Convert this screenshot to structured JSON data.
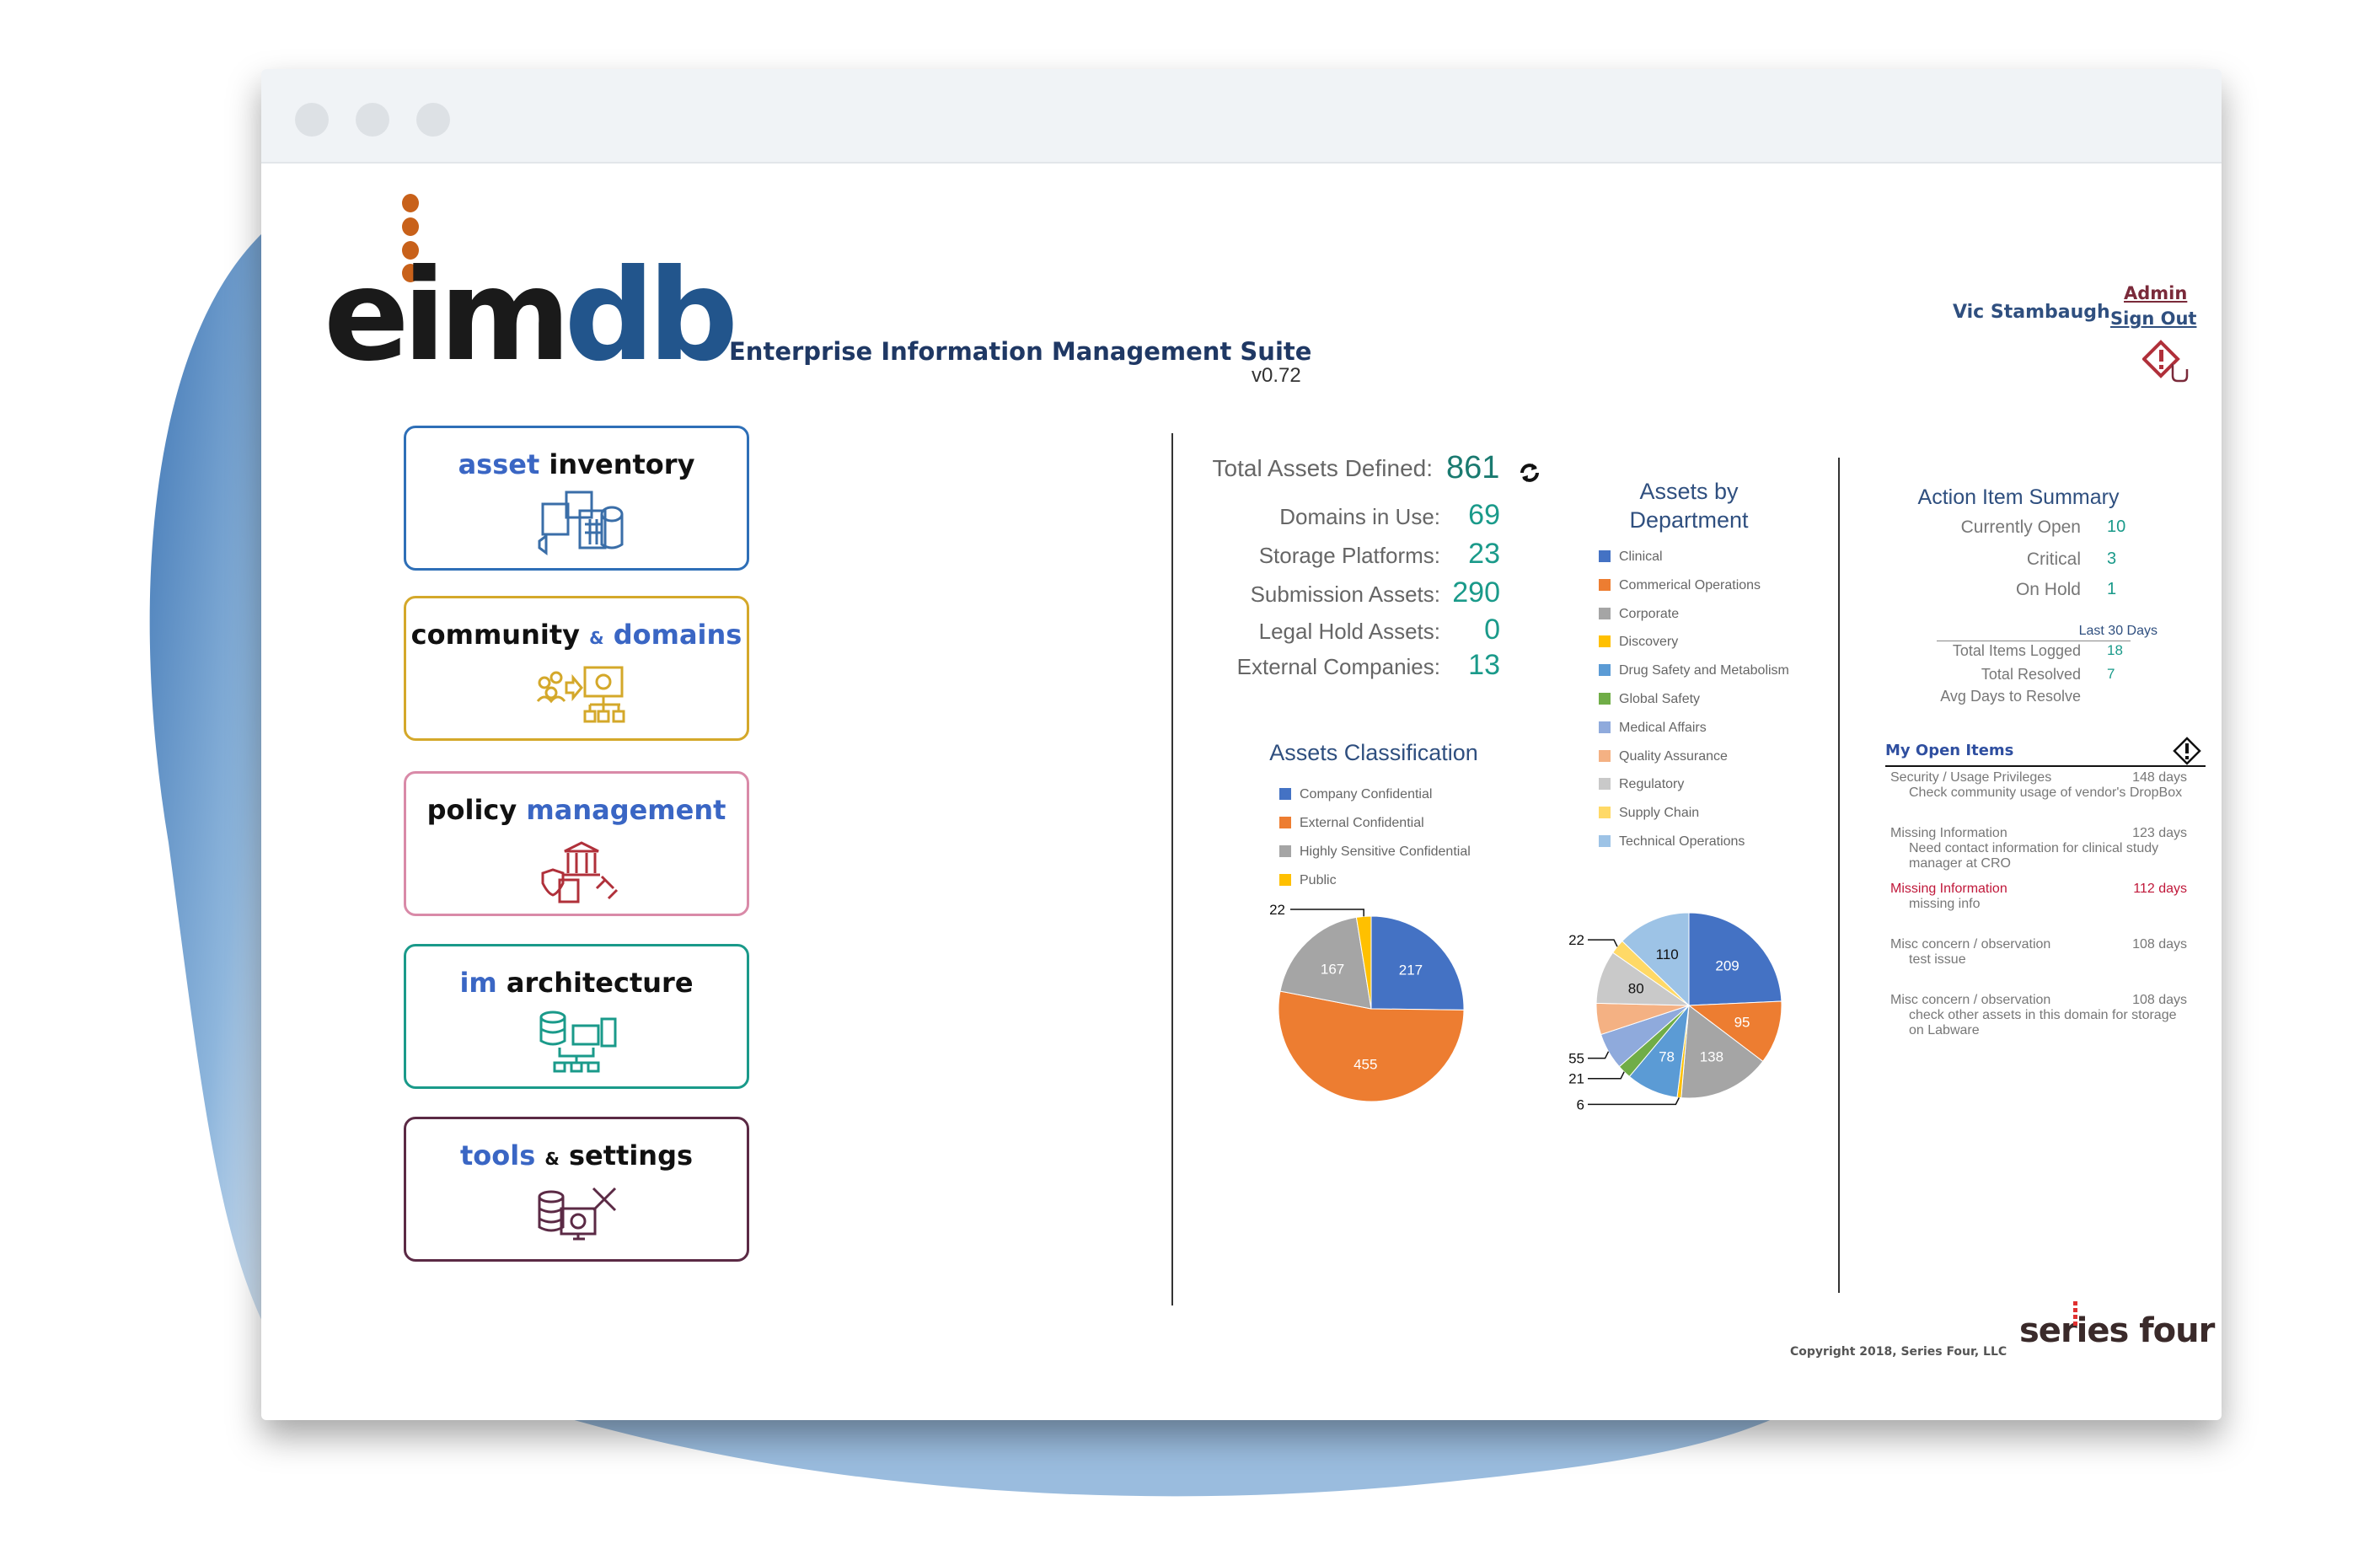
{
  "header": {
    "logo_text": "eimdb",
    "suite_title": "Enterprise Information Management Suite",
    "version": "v0.72",
    "user_name": "Vic Stambaugh",
    "admin_link": "Admin",
    "sign_out_link": "Sign Out",
    "report_issue_icon": "alert-diamond-pointer-icon"
  },
  "tiles": [
    {
      "word1": "asset",
      "word2": "inventory",
      "border": "#2e6fb7",
      "icon": "asset-collection-icon"
    },
    {
      "word1": "community",
      "amp": "&",
      "word2": "domains",
      "border": "#d4a82a",
      "icon": "community-domains-icon"
    },
    {
      "word1": "policy",
      "word2": "management",
      "border": "#d98aa8",
      "icon": "policy-gavel-icon"
    },
    {
      "word1": "im",
      "word2": "architecture",
      "border": "#1a9a8a",
      "icon": "architecture-database-icon"
    },
    {
      "word1": "tools",
      "amp": "&",
      "word2": "settings",
      "border": "#5b2a45",
      "icon": "tools-settings-icon"
    }
  ],
  "stats": {
    "total_label": "Total Assets Defined:",
    "total_value": "861",
    "refresh_icon": "refresh-icon",
    "rows": [
      {
        "label": "Domains in Use:",
        "value": "69"
      },
      {
        "label": "Storage Platforms:",
        "value": "23"
      },
      {
        "label": "Submission Assets:",
        "value": "290"
      },
      {
        "label": "Legal Hold Assets:",
        "value": "0"
      },
      {
        "label": "External Companies:",
        "value": "13"
      }
    ]
  },
  "chart_data": [
    {
      "type": "pie",
      "title": "Assets Classification",
      "legend_position": "top",
      "slices": [
        {
          "name": "Company Confidential",
          "value": 217,
          "color": "#4472c4"
        },
        {
          "name": "External Confidential",
          "value": 455,
          "color": "#ed7d31"
        },
        {
          "name": "Highly Sensitive Confidential",
          "value": 167,
          "color": "#a5a5a5"
        },
        {
          "name": "Public",
          "value": 22,
          "color": "#ffc000"
        }
      ]
    },
    {
      "type": "pie",
      "title_line1": "Assets by",
      "title_line2": "Department",
      "legend_position": "top",
      "slices": [
        {
          "name": "Clinical",
          "value": 209,
          "color": "#4472c4"
        },
        {
          "name": "Commerical Operations",
          "value": 95,
          "color": "#ed7d31"
        },
        {
          "name": "Corporate",
          "value": 138,
          "color": "#a5a5a5"
        },
        {
          "name": "Discovery",
          "value": 6,
          "color": "#ffc000"
        },
        {
          "name": "Drug Safety and Metabolism",
          "value": 78,
          "color": "#5b9bd5"
        },
        {
          "name": "Global Safety",
          "value": 21,
          "color": "#70ad47"
        },
        {
          "name": "Medical Affairs",
          "value": 55,
          "color": "#8faadc"
        },
        {
          "name": "Quality Assurance",
          "value": 47,
          "color": "#f4b183",
          "label_shown": false
        },
        {
          "name": "Regulatory",
          "value": 80,
          "color": "#c9c9c9"
        },
        {
          "name": "Supply Chain",
          "value": 22,
          "color": "#ffd966"
        },
        {
          "name": "Technical Operations",
          "value": 110,
          "color": "#9dc3e6"
        }
      ]
    }
  ],
  "action_summary": {
    "title": "Action Item Summary",
    "rows": [
      {
        "label": "Currently Open",
        "value": "10"
      },
      {
        "label": "Critical",
        "value": "3"
      },
      {
        "label": "On Hold",
        "value": "1"
      }
    ],
    "period_label": "Last 30 Days",
    "period_rows": [
      {
        "label": "Total Items Logged",
        "value": "18"
      },
      {
        "label": "Total Resolved",
        "value": "7"
      },
      {
        "label": "Avg Days to Resolve",
        "value": ""
      }
    ]
  },
  "open_items": {
    "title": "My Open Items",
    "icon": "alert-diamond-icon",
    "items": [
      {
        "title": "Security / Usage Privileges",
        "days": "148 days",
        "desc": "Check community usage of vendor's DropBox",
        "critical": false
      },
      {
        "title": "Missing Information",
        "days": "123 days",
        "desc": "Need contact information for clinical study manager at CRO",
        "critical": false
      },
      {
        "title": "Missing Information",
        "days": "112 days",
        "desc": "missing info",
        "critical": true
      },
      {
        "title": "Misc concern / observation",
        "days": "108 days",
        "desc": "test issue",
        "critical": false
      },
      {
        "title": "Misc concern / observation",
        "days": "108 days",
        "desc": "check other assets in this domain for storage on Labware",
        "critical": false
      }
    ]
  },
  "footer": {
    "copyright": "Copyright 2018, Series Four, LLC",
    "company_logo": "series four"
  },
  "colors": {
    "accent_teal": "#1a9a8a",
    "navy": "#1f3864",
    "logo_blue": "#22558c",
    "logo_orange": "#c8611a",
    "critical": "#c0183a"
  }
}
